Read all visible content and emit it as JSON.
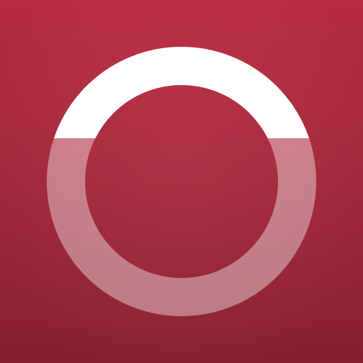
{
  "icon": {
    "name": "ring-logo-icon",
    "colors": {
      "background_top": "#c12e45",
      "background_bottom": "#8e2232",
      "ring_upper": "#ffffff",
      "ring_lower": "#ffffff",
      "ring_lower_opacity": "0.4"
    }
  }
}
